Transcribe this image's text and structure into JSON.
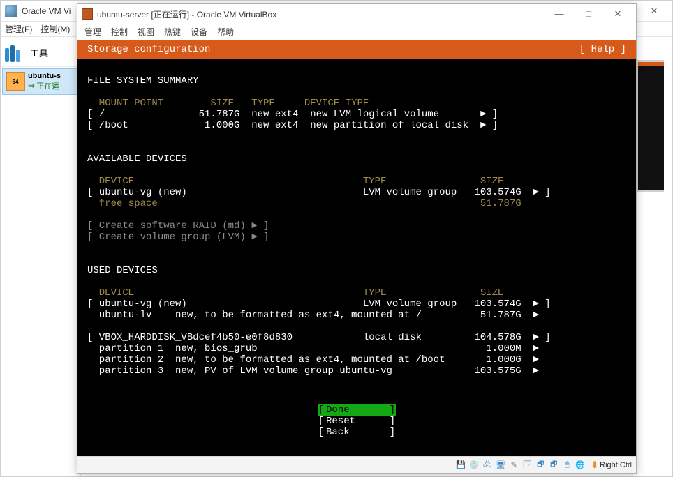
{
  "outer": {
    "title": "Oracle VM Vi",
    "close_glyph": "✕",
    "menu": {
      "manage": "管理(F)",
      "control": "控制(M)"
    },
    "tools_label": "工具",
    "vm": {
      "name": "ubuntu-s",
      "status_prefix": "正在运",
      "arrow": "⇒"
    }
  },
  "vm_window": {
    "title": "ubuntu-server [正在运行] - Oracle VM VirtualBox",
    "controls": {
      "min": "—",
      "max": "□",
      "close": "✕"
    },
    "menu": {
      "manage": "管理",
      "control": "控制",
      "view": "视图",
      "hotkey": "热键",
      "device": "设备",
      "help": "帮助"
    }
  },
  "installer": {
    "title": "Storage configuration",
    "help": "[ Help ]",
    "fs_summary_hdr": "FILE SYSTEM SUMMARY",
    "fs_cols": "  MOUNT POINT        SIZE   TYPE     DEVICE TYPE",
    "fs_rows": [
      "[ /                51.787G  new ext4  new LVM logical volume       ► ]",
      "[ /boot             1.000G  new ext4  new partition of local disk  ► ]"
    ],
    "avail_hdr": "AVAILABLE DEVICES",
    "avail_cols": "  DEVICE                                       TYPE                SIZE",
    "avail_rows": [
      "[ ubuntu-vg (new)                              LVM volume group   103.574G  ► ]",
      "  free space                                                       51.787G"
    ],
    "raid": "[ Create software RAID (md) ► ]",
    "lvm": "[ Create volume group (LVM) ► ]",
    "used_hdr": "USED DEVICES",
    "used_cols": "  DEVICE                                       TYPE                SIZE",
    "used_rows": [
      "[ ubuntu-vg (new)                              LVM volume group   103.574G  ► ]",
      "  ubuntu-lv    new, to be formatted as ext4, mounted at /          51.787G  ►",
      "",
      "[ VBOX_HARDDISK_VBdcef4b50-e0f8d830            local disk         104.578G  ► ]",
      "  partition 1  new, bios_grub                                       1.000M  ►",
      "  partition 2  new, to be formatted as ext4, mounted at /boot       1.000G  ►",
      "  partition 3  new, PV of LVM volume group ubuntu-vg              103.575G  ►"
    ],
    "actions": {
      "done": "Done",
      "reset": "Reset",
      "back": "Back"
    }
  },
  "statusbar": {
    "host_key": "Right Ctrl",
    "icons": [
      "💾",
      "💿",
      "🖧",
      "🖥",
      "✎",
      "🗔",
      "🗗",
      "🗗",
      "🖱",
      "🌐",
      "⬇"
    ]
  }
}
